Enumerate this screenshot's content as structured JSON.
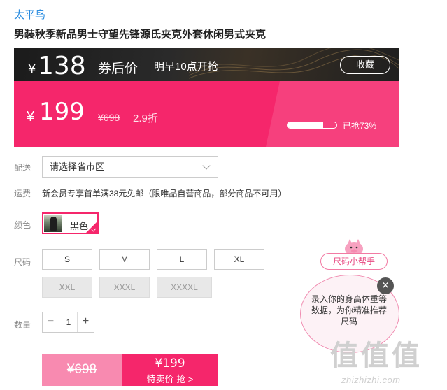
{
  "product": {
    "brand": "太平鸟",
    "title": "男装秋季新品男士守望先锋源氏夹克外套休闲男式夹克"
  },
  "promo": {
    "currency": "¥",
    "coupon_price": "138",
    "coupon_label": "券后价",
    "start_time": "明早10点开抢",
    "favorite_label": "收藏"
  },
  "price": {
    "currency": "¥",
    "sale_price": "199",
    "original_price": "¥698",
    "discount": "2.9折",
    "sold_label": "已抢73%",
    "sold_percent": 73
  },
  "shipping": {
    "label": "配送",
    "placeholder": "请选择省市区"
  },
  "freight": {
    "label": "运费",
    "text": "新会员专享首单满38元免邮（限唯品自营商品，部分商品不可用）"
  },
  "color": {
    "label": "颜色",
    "options": [
      {
        "name": "黑色",
        "selected": true
      }
    ]
  },
  "size": {
    "label": "尺码",
    "options": [
      {
        "name": "S",
        "available": true
      },
      {
        "name": "M",
        "available": true
      },
      {
        "name": "L",
        "available": true
      },
      {
        "name": "XL",
        "available": true
      },
      {
        "name": "XXL",
        "available": false
      },
      {
        "name": "XXXL",
        "available": false
      },
      {
        "name": "XXXXL",
        "available": false
      }
    ]
  },
  "quantity": {
    "label": "数量",
    "value": "1",
    "minus": "−",
    "plus": "+"
  },
  "buy": {
    "original_price": "¥698",
    "special_price": "¥199",
    "action_label": "特卖价 抢 >"
  },
  "size_helper": {
    "tag": "尺码小帮手",
    "message": "录入你的身高体重等数据，为你精准推荐尺码",
    "close": "×"
  },
  "watermark": {
    "logo": "值值值",
    "url": "zhizhizhi.com"
  },
  "colors": {
    "accent": "#f5266b",
    "accent_light": "#f88ab0",
    "brand_link": "#2a8ce0",
    "dark_banner": "#1b1b1b"
  }
}
